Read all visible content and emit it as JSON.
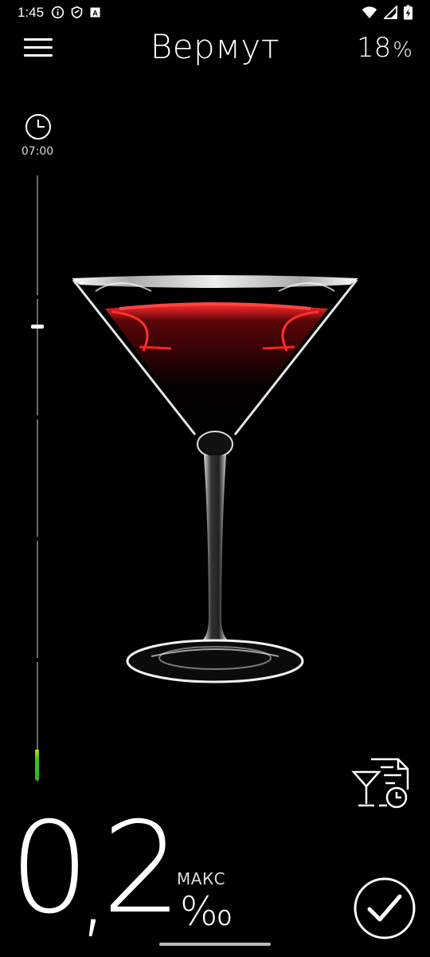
{
  "status": {
    "time": "1:45",
    "icons": [
      "info-circle-icon",
      "shield-icon",
      "a-badge-icon",
      "wifi-icon",
      "signal-icon",
      "battery-icon"
    ]
  },
  "header": {
    "menu_icon": "hamburger-menu-icon",
    "title": "Вермут",
    "abv_value": "18",
    "abv_unit": "%"
  },
  "timeline": {
    "clock_icon": "clock-icon",
    "start_time": "07:00",
    "level_color_top": "#c9d600",
    "level_color_bottom": "#27b61a"
  },
  "drink": {
    "image": "martini-glass-vermouth",
    "liquid_color": "#d8141c"
  },
  "history_button": {
    "icon": "drink-history-icon"
  },
  "reading": {
    "integer": "0",
    "separator": ",",
    "decimal": "2",
    "max_label": "МАКС",
    "unit": "‰"
  },
  "confirm_button": {
    "icon": "checkmark-icon"
  }
}
